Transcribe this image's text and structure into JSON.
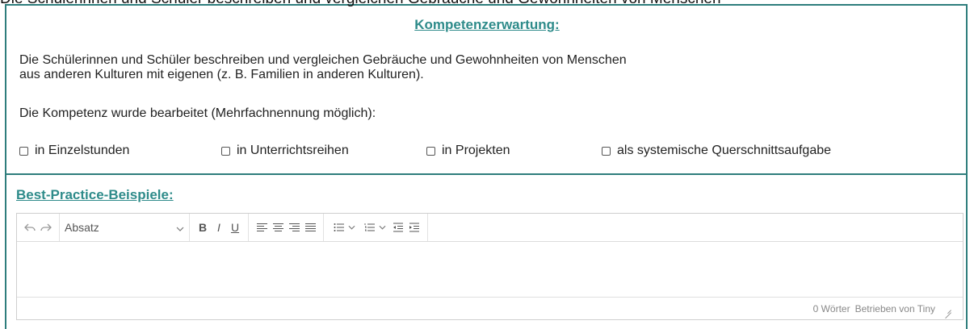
{
  "top_text": "Die Schülerinnen und Schüler beschreiben und vergleichen Gebräuche und Gewohnheiten von Menschen",
  "header": {
    "title": "Kompetenzerwartung:"
  },
  "description": {
    "line1": "Die Schülerinnen und Schüler beschreiben und vergleichen Gebräuche und Gewohnheiten von Menschen",
    "line2": "aus anderen Kulturen mit eigenen (z. B. Familien in anderen Kulturen)."
  },
  "prompt": "Die Kompetenz wurde bearbeitet (Mehrfachnennung möglich):",
  "checkboxes": [
    {
      "label": "in Einzelstunden",
      "checked": false
    },
    {
      "label": "in Unterrichtsreihen",
      "checked": false
    },
    {
      "label": "in Projekten",
      "checked": false
    },
    {
      "label": "als systemische Querschnittsaufgabe",
      "checked": false
    }
  ],
  "best_practice": {
    "title": "Best-Practice-Beispiele:"
  },
  "editor": {
    "format_select": "Absatz",
    "bold": "B",
    "italic": "I",
    "underline": "U",
    "word_count": "0 Wörter",
    "powered_by": "Betrieben von Tiny"
  },
  "colors": {
    "accent": "#2e8b8a",
    "border": "#2e7d7c"
  },
  "icons": [
    "undo-icon",
    "redo-icon",
    "chevron-down-icon",
    "align-left-icon",
    "align-center-icon",
    "align-right-icon",
    "align-justify-icon",
    "bullet-list-icon",
    "numbered-list-icon",
    "outdent-icon",
    "indent-icon",
    "resize-handle-icon"
  ]
}
